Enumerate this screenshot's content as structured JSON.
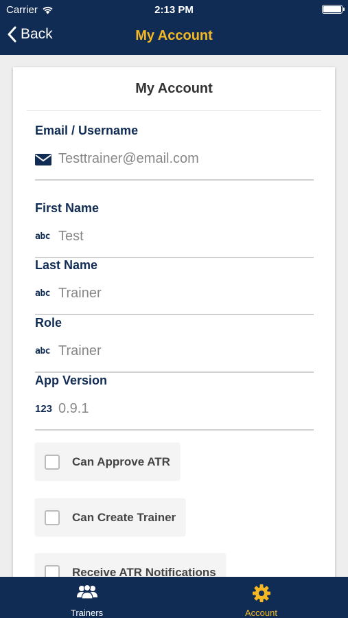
{
  "status_bar": {
    "carrier": "Carrier",
    "time": "2:13 PM"
  },
  "nav": {
    "back_label": "Back",
    "title": "My Account"
  },
  "card": {
    "title": "My Account",
    "fields": [
      {
        "label": "Email / Username",
        "value": "Testtrainer@email.com",
        "icon": "envelope-icon"
      },
      {
        "label": "First Name",
        "value": "Test",
        "icon": "abc-icon",
        "icon_text": "abc"
      },
      {
        "label": "Last Name",
        "value": "Trainer",
        "icon": "abc-icon",
        "icon_text": "abc"
      },
      {
        "label": "Role",
        "value": "Trainer",
        "icon": "abc-icon",
        "icon_text": "abc"
      },
      {
        "label": "App Version",
        "value": "0.9.1",
        "icon": "numbers-icon",
        "icon_text": "123"
      }
    ],
    "checkboxes": [
      {
        "label": "Can Approve ATR",
        "checked": false
      },
      {
        "label": "Can Create Trainer",
        "checked": false
      },
      {
        "label": "Receive ATR Notifications",
        "checked": false
      }
    ]
  },
  "tabbar": {
    "tabs": [
      {
        "label": "Trainers",
        "icon": "people-icon",
        "active": false
      },
      {
        "label": "Account",
        "icon": "gear-icon",
        "active": true
      }
    ]
  },
  "colors": {
    "navy": "#112c54",
    "accent": "#f5b723",
    "label": "#112c54",
    "value": "#888888"
  }
}
